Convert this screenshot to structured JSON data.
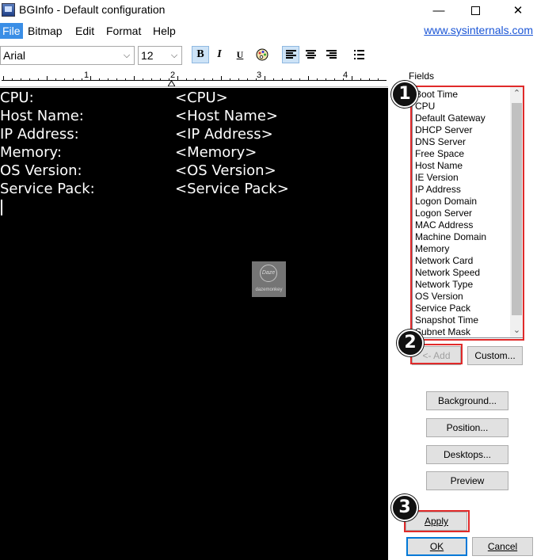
{
  "window": {
    "title": "BGInfo - Default configuration",
    "minimize": "—",
    "close": "✕"
  },
  "menu": {
    "items": [
      "File",
      "Bitmap",
      "Edit",
      "Format",
      "Help"
    ],
    "link": "www.sysinternals.com"
  },
  "toolbar": {
    "font_value": "Arial",
    "size_value": "12",
    "bold": "B",
    "italic": "I",
    "underline": "U"
  },
  "ruler": {
    "numbers": [
      "1",
      "2",
      "3",
      "4"
    ]
  },
  "editor": {
    "lines": [
      {
        "label": "CPU:",
        "value": "<CPU>"
      },
      {
        "label": "Host Name:",
        "value": "<Host Name>"
      },
      {
        "label": "IP Address:",
        "value": "<IP Address>"
      },
      {
        "label": "Memory:",
        "value": "<Memory>"
      },
      {
        "label": "OS Version:",
        "value": "<OS Version>"
      },
      {
        "label": "Service Pack:",
        "value": "<Service Pack>"
      }
    ],
    "watermark_logo": "Daze",
    "watermark_text": "dazemonkey"
  },
  "fields": {
    "label": "Fields",
    "items": [
      "Boot Time",
      "CPU",
      "Default Gateway",
      "DHCP Server",
      "DNS Server",
      "Free Space",
      "Host Name",
      "IE Version",
      "IP Address",
      "Logon Domain",
      "Logon Server",
      "MAC Address",
      "Machine Domain",
      "Memory",
      "Network Card",
      "Network Speed",
      "Network Type",
      "OS Version",
      "Service Pack",
      "Snapshot Time",
      "Subnet Mask"
    ]
  },
  "buttons": {
    "add": "<- Add",
    "custom": "Custom...",
    "background": "Background...",
    "position": "Position...",
    "desktops": "Desktops...",
    "preview": "Preview",
    "apply": "Apply",
    "ok": "OK",
    "cancel": "Cancel"
  },
  "annotations": {
    "badge1": "1",
    "badge2": "2",
    "badge3": "3",
    "highlight_color": "#e02a2a"
  },
  "colors": {
    "editor_bg": "#000000",
    "menu_active": "#3a8ee6",
    "link": "#1a55d6"
  }
}
